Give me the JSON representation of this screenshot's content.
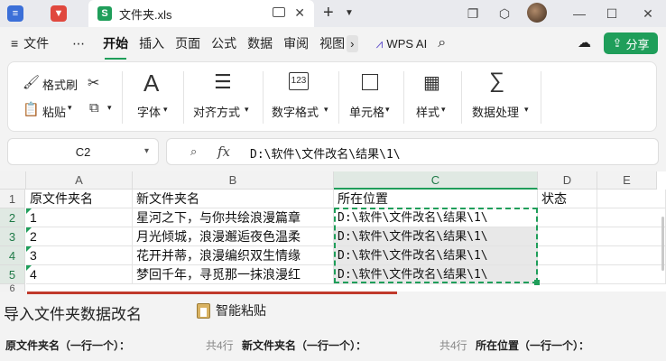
{
  "titlebar": {
    "tab_title": "文件夹.xls",
    "tab_icon": "S"
  },
  "menu": {
    "file": "文件",
    "more": "⋯",
    "items": [
      "开始",
      "插入",
      "页面",
      "公式",
      "数据",
      "审阅",
      "视图"
    ],
    "wps_ai": "WPS AI",
    "share": "分享"
  },
  "ribbon": {
    "format_painter": "格式刷",
    "paste": "粘贴",
    "font": "字体",
    "align": "对齐方式",
    "number_format": "数字格式",
    "cell": "单元格",
    "style": "样式",
    "data_process": "数据处理"
  },
  "formula": {
    "cell_ref": "C2",
    "fx": "fx",
    "value": "D:\\软件\\文件改名\\结果\\1\\"
  },
  "sheet": {
    "columns": [
      "A",
      "B",
      "C",
      "D",
      "E"
    ],
    "rows": [
      "1",
      "2",
      "3",
      "4",
      "5",
      "6"
    ],
    "header": [
      "原文件夹名",
      "新文件夹名",
      "所在位置",
      "状态"
    ],
    "data": [
      [
        "1",
        "星河之下，与你共绘浪漫篇章",
        "D:\\软件\\文件改名\\结果\\1\\"
      ],
      [
        "2",
        "月光倾城，浪漫邂逅夜色温柔",
        "D:\\软件\\文件改名\\结果\\1\\"
      ],
      [
        "3",
        "花开并蒂，浪漫编织双生情缘",
        "D:\\软件\\文件改名\\结果\\1\\"
      ],
      [
        "4",
        "梦回千年，寻觅那一抹浪漫红",
        "D:\\软件\\文件改名\\结果\\1\\"
      ]
    ]
  },
  "panel": {
    "title": "导入文件夹数据改名",
    "paste_btn": "智能粘贴",
    "cols": [
      {
        "count": "",
        "label": "原文件夹名（一行一个）：",
        "hint": ""
      },
      {
        "count": "共4行",
        "label": "新文件夹名（一行一个）：",
        "hint": ""
      },
      {
        "count": "共4行",
        "label": "所在位置（一行一个）：",
        "hint": ""
      }
    ]
  },
  "colors": {
    "accent": "#1f9e5a",
    "selection": "#e8e8e8"
  }
}
